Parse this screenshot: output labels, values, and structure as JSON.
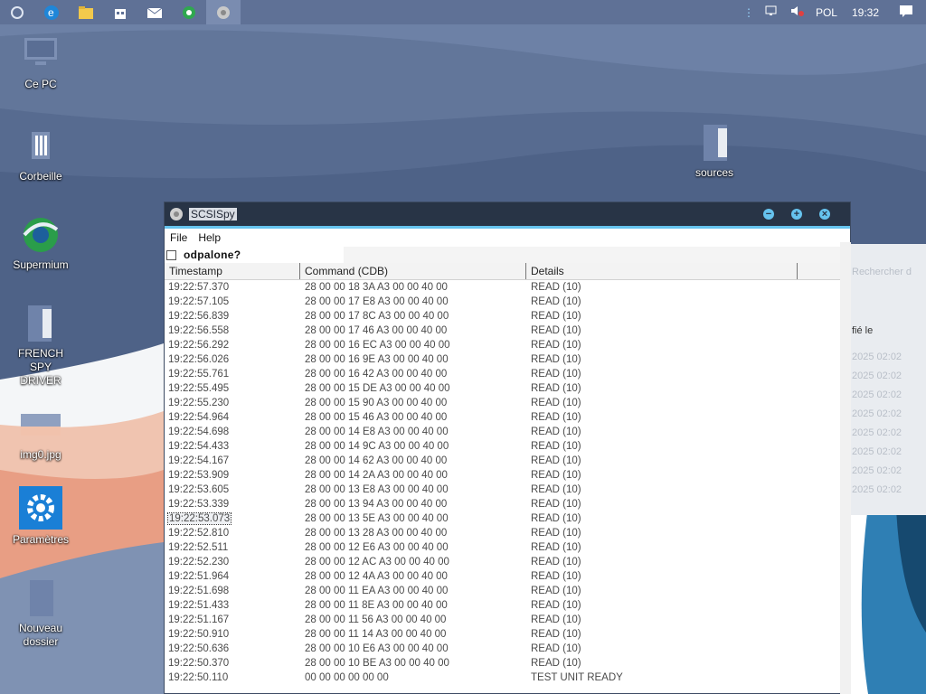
{
  "taskbar": {
    "apps": [
      "start-icon",
      "edge-icon",
      "file-explorer-icon",
      "store-icon",
      "mail-icon",
      "supermium-icon",
      "scsispy-icon"
    ],
    "tray": {
      "chevron": "⋮",
      "language": "POL",
      "time": "19:32"
    }
  },
  "desktop": {
    "icons": [
      {
        "label": "Ce PC"
      },
      {
        "label": "Corbeille"
      },
      {
        "label": "Supermium"
      },
      {
        "label": "FRENCH SPY DRIVER"
      },
      {
        "label": "img0.jpg"
      },
      {
        "label": "Paramètres"
      },
      {
        "label": "Nouveau dossier"
      },
      {
        "label": "sources"
      }
    ]
  },
  "background_window": {
    "search": "Rechercher d",
    "modified": "fié le",
    "dates": [
      "2025 02:02",
      "2025 02:02",
      "2025 02:02",
      "2025 02:02",
      "2025 02:02",
      "2025 02:02",
      "2025 02:02",
      "2025 02:02"
    ]
  },
  "window": {
    "title": "SCSISpy",
    "controls": {
      "minimize": "−",
      "maximize": "+",
      "close": "×"
    },
    "menu": {
      "file": "File",
      "help": "Help"
    },
    "checkbox_label": "odpalone?",
    "columns": {
      "timestamp": "Timestamp",
      "command": "Command (CDB)",
      "details": "Details"
    },
    "rows": [
      {
        "t": "19:22:57.370",
        "c": "28 00 00 18 3A A3 00 00 40 00",
        "d": "READ (10)"
      },
      {
        "t": "19:22:57.105",
        "c": "28 00 00 17 E8 A3 00 00 40 00",
        "d": "READ (10)"
      },
      {
        "t": "19:22:56.839",
        "c": "28 00 00 17 8C A3 00 00 40 00",
        "d": "READ (10)"
      },
      {
        "t": "19:22:56.558",
        "c": "28 00 00 17 46 A3 00 00 40 00",
        "d": "READ (10)"
      },
      {
        "t": "19:22:56.292",
        "c": "28 00 00 16 EC A3 00 00 40 00",
        "d": "READ (10)"
      },
      {
        "t": "19:22:56.026",
        "c": "28 00 00 16 9E A3 00 00 40 00",
        "d": "READ (10)"
      },
      {
        "t": "19:22:55.761",
        "c": "28 00 00 16 42 A3 00 00 40 00",
        "d": "READ (10)"
      },
      {
        "t": "19:22:55.495",
        "c": "28 00 00 15 DE A3 00 00 40 00",
        "d": "READ (10)"
      },
      {
        "t": "19:22:55.230",
        "c": "28 00 00 15 90 A3 00 00 40 00",
        "d": "READ (10)"
      },
      {
        "t": "19:22:54.964",
        "c": "28 00 00 15 46 A3 00 00 40 00",
        "d": "READ (10)"
      },
      {
        "t": "19:22:54.698",
        "c": "28 00 00 14 E8 A3 00 00 40 00",
        "d": "READ (10)"
      },
      {
        "t": "19:22:54.433",
        "c": "28 00 00 14 9C A3 00 00 40 00",
        "d": "READ (10)"
      },
      {
        "t": "19:22:54.167",
        "c": "28 00 00 14 62 A3 00 00 40 00",
        "d": "READ (10)"
      },
      {
        "t": "19:22:53.909",
        "c": "28 00 00 14 2A A3 00 00 40 00",
        "d": "READ (10)"
      },
      {
        "t": "19:22:53.605",
        "c": "28 00 00 13 E8 A3 00 00 40 00",
        "d": "READ (10)"
      },
      {
        "t": "19:22:53.339",
        "c": "28 00 00 13 94 A3 00 00 40 00",
        "d": "READ (10)"
      },
      {
        "t": "19:22:53.073",
        "c": "28 00 00 13 5E A3 00 00 40 00",
        "d": "READ (10)"
      },
      {
        "t": "19:22:52.810",
        "c": "28 00 00 13 28 A3 00 00 40 00",
        "d": "READ (10)"
      },
      {
        "t": "19:22:52.511",
        "c": "28 00 00 12 E6 A3 00 00 40 00",
        "d": "READ (10)"
      },
      {
        "t": "19:22:52.230",
        "c": "28 00 00 12 AC A3 00 00 40 00",
        "d": "READ (10)"
      },
      {
        "t": "19:22:51.964",
        "c": "28 00 00 12 4A A3 00 00 40 00",
        "d": "READ (10)"
      },
      {
        "t": "19:22:51.698",
        "c": "28 00 00 11 EA A3 00 00 40 00",
        "d": "READ (10)"
      },
      {
        "t": "19:22:51.433",
        "c": "28 00 00 11 8E A3 00 00 40 00",
        "d": "READ (10)"
      },
      {
        "t": "19:22:51.167",
        "c": "28 00 00 11 56 A3 00 00 40 00",
        "d": "READ (10)"
      },
      {
        "t": "19:22:50.910",
        "c": "28 00 00 11 14 A3 00 00 40 00",
        "d": "READ (10)"
      },
      {
        "t": "19:22:50.636",
        "c": "28 00 00 10 E6 A3 00 00 40 00",
        "d": "READ (10)"
      },
      {
        "t": "19:22:50.370",
        "c": "28 00 00 10 BE A3 00 00 40 00",
        "d": "READ (10)"
      },
      {
        "t": "19:22:50.110",
        "c": "00 00 00 00 00 00",
        "d": "TEST UNIT READY"
      }
    ],
    "selected_row": 16
  }
}
